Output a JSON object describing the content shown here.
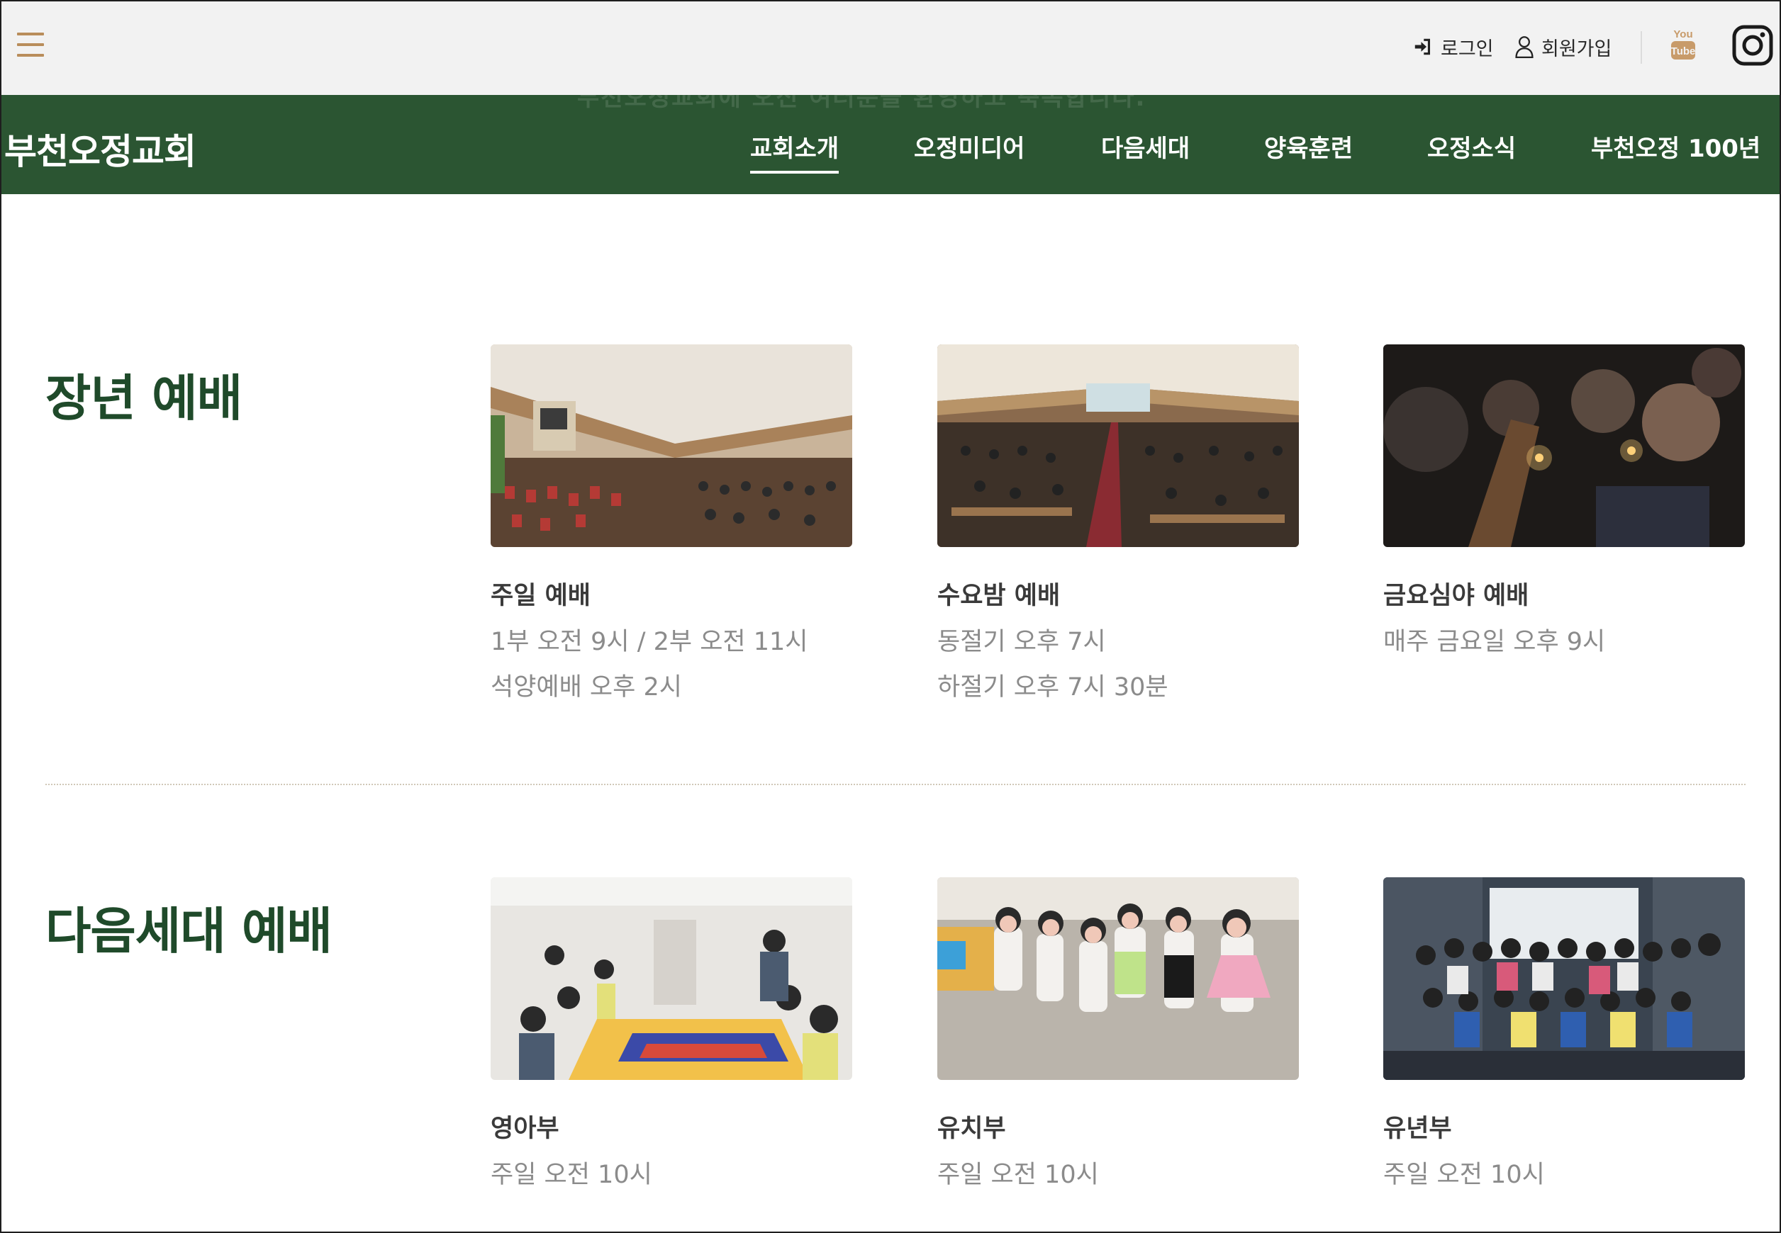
{
  "header": {
    "login_label": "로그인",
    "join_label": "회원가입",
    "youtube_icon": "youtube-icon",
    "instagram_icon": "instagram-icon",
    "accent_color": "#b98d5b"
  },
  "nav": {
    "brand": "부천오정교회",
    "ghost_text": "부천오정교회에 오신 여러분을 환영하고 축복합니다.",
    "items": [
      {
        "label": "교회소개",
        "active": true
      },
      {
        "label": "오정미디어"
      },
      {
        "label": "다음세대"
      },
      {
        "label": "양육훈련"
      },
      {
        "label": "오정소식"
      },
      {
        "label": "부천오정 100년"
      }
    ],
    "background": "#2b5532"
  },
  "sections": [
    {
      "title": "장년 예배",
      "cards": [
        {
          "title": "주일 예배",
          "lines": [
            "1부 오전 9시 / 2부 오전 11시",
            "석양예배 오후 2시"
          ]
        },
        {
          "title": "수요밤 예배",
          "lines": [
            "동절기 오후 7시",
            "하절기 오후 7시 30분"
          ]
        },
        {
          "title": "금요심야 예배",
          "lines": [
            "매주 금요일 오후 9시"
          ]
        }
      ]
    },
    {
      "title": "다음세대 예배",
      "cards": [
        {
          "title": "영아부",
          "lines": [
            "주일 오전 10시"
          ]
        },
        {
          "title": "유치부",
          "lines": [
            "주일 오전 10시"
          ]
        },
        {
          "title": "유년부",
          "lines": [
            "주일 오전 10시"
          ]
        }
      ]
    }
  ]
}
